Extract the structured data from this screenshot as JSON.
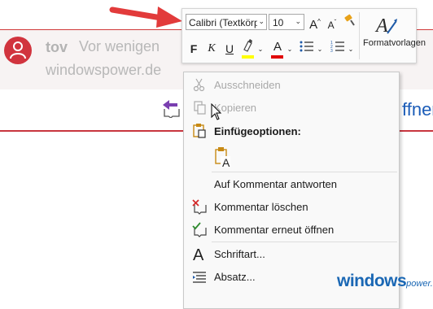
{
  "comment": {
    "author": "tov",
    "time": "Vor wenigen",
    "domain": "windowspower.de",
    "reopen_partial": "ffnen",
    "avatar_color": "#d1343e"
  },
  "mini_toolbar": {
    "font_name": "Calibri (Textkörp",
    "font_size": "10",
    "grow_label": "A",
    "shrink_label": "A",
    "bold_label": "F",
    "italic_label": "K",
    "underline_label": "U",
    "font_color_label": "A",
    "highlight_color": "#ffff00",
    "font_color": "#e00000",
    "styles_label": "Formatvorlagen"
  },
  "context_menu": {
    "items": [
      {
        "label": "Ausschneiden",
        "icon": "scissors-icon",
        "enabled": false
      },
      {
        "label": "Kopieren",
        "icon": "copy-icon",
        "enabled": false
      },
      {
        "label": "Einfügeoptionen:",
        "icon": "paste-icon",
        "header": true
      },
      {
        "label": "Auf Kommentar antworten",
        "icon": null
      },
      {
        "label": "Kommentar löschen",
        "icon": "delete-comment-icon"
      },
      {
        "label": "Kommentar erneut öffnen",
        "icon": "reopen-comment-icon"
      },
      {
        "label": "Schriftart...",
        "icon": "font-icon"
      },
      {
        "label": "Absatz...",
        "icon": "paragraph-icon"
      }
    ],
    "paste_option_glyph": "A"
  },
  "watermark": {
    "brand": "windows",
    "suffix": "power.de"
  },
  "colors": {
    "accent_red": "#d03a3a",
    "link_blue": "#1b5cb8",
    "arrow_red": "#e23b3b"
  }
}
